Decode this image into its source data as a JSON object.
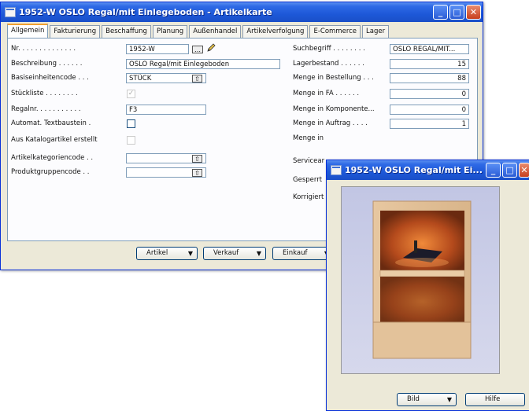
{
  "main_window": {
    "title": "1952-W OSLO Regal/mit Einlegeboden - Artikelkarte",
    "tabs": [
      "Allgemein",
      "Fakturierung",
      "Beschaffung",
      "Planung",
      "Außenhandel",
      "Artikelverfolgung",
      "E-Commerce",
      "Lager"
    ],
    "active_tab": "Allgemein",
    "left_fields": {
      "nr": {
        "label": "Nr. . . . . . . . . . . . . .",
        "value": "1952-W"
      },
      "beschreibung": {
        "label": "Beschreibung . . . . . .",
        "value": "OSLO Regal/mit Einlegeboden"
      },
      "basiseinheitencode": {
        "label": "Basiseinheitencode . . .",
        "value": "STÜCK"
      },
      "stueckliste": {
        "label": "Stückliste . . . . . . . .",
        "checked": true
      },
      "regalnr": {
        "label": "Regalnr. . . . . . . . . . .",
        "value": "F3"
      },
      "textbaustein": {
        "label": "Automat. Textbaustein .",
        "checked": false
      },
      "katalogartikel": {
        "label": "Aus Katalogartikel erstellt",
        "checked": false
      },
      "artikelkategoriencode": {
        "label": "Artikelkategoriencode . .",
        "value": ""
      },
      "produktgruppencode": {
        "label": "Produktgruppencode . .",
        "value": ""
      }
    },
    "right_fields": {
      "suchbegriff": {
        "label": "Suchbegriff . . . . . . . .",
        "value": "OSLO REGAL/MIT..."
      },
      "lagerbestand": {
        "label": "Lagerbestand . . . . . .",
        "value": "15"
      },
      "menge_bestellung": {
        "label": "Menge in Bestellung . . .",
        "value": "88"
      },
      "menge_fa": {
        "label": "Menge in FA . . . . . .",
        "value": "0"
      },
      "menge_komponente": {
        "label": "Menge in Komponente...",
        "value": "0"
      },
      "menge_auftrag": {
        "label": "Menge in Auftrag . . . .",
        "value": "1"
      },
      "menge_in": {
        "label": "Menge in"
      },
      "servicear": {
        "label": "Servicear"
      },
      "gesperrt": {
        "label": "Gesperrt"
      },
      "korrigiert": {
        "label": "Korrigiert"
      }
    },
    "buttons": {
      "artikel": "Artikel",
      "verkauf": "Verkauf",
      "einkauf": "Einkauf"
    }
  },
  "picture_window": {
    "title": "1952-W OSLO Regal/mit Ei...",
    "buttons": {
      "bild": "Bild",
      "hilfe": "Hilfe"
    }
  },
  "colors": {
    "titlebar": "#2f6ae6",
    "window_bg": "#ece9d8",
    "tab_accent": "#f0a030"
  }
}
